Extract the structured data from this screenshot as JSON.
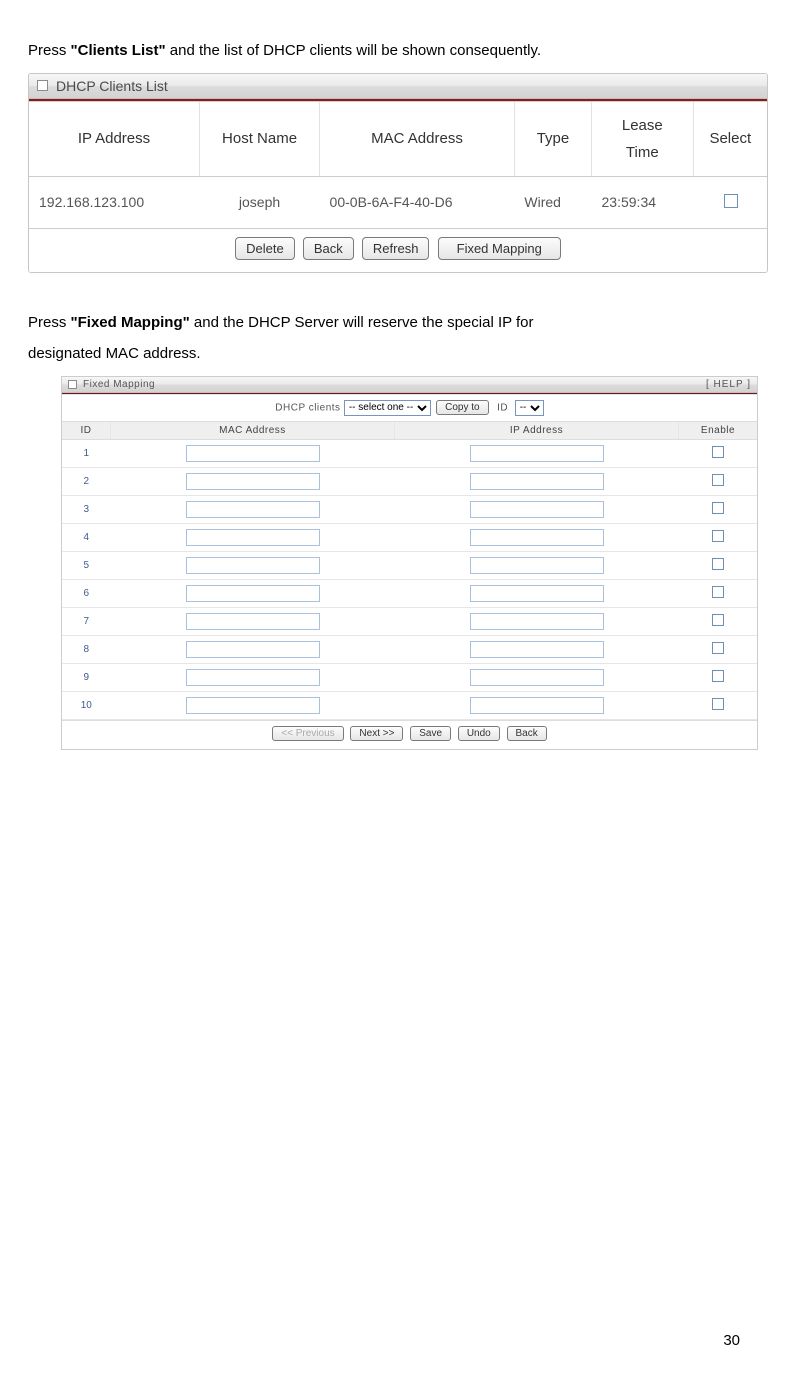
{
  "intro": {
    "pre": "Press ",
    "bold": "\"Clients List\"",
    "post": " and the list of DHCP clients will be shown consequently."
  },
  "clients_panel": {
    "title": "DHCP Clients List",
    "columns": {
      "ip": "IP Address",
      "host": "Host Name",
      "mac": "MAC Address",
      "type": "Type",
      "lease1": "Lease",
      "lease2": "Time",
      "select": "Select"
    },
    "row": {
      "ip": "192.168.123.100",
      "host": "joseph",
      "mac": "00-0B-6A-F4-40-D6",
      "type": "Wired",
      "lease": "23:59:34"
    },
    "buttons": {
      "delete": "Delete",
      "back": "Back",
      "refresh": "Refresh",
      "fixed": "Fixed Mapping"
    }
  },
  "intro2": {
    "pre": "Press ",
    "bold": "\"Fixed Mapping\"",
    "post1": " and the DHCP Server will reserve the special IP for",
    "post2": "designated MAC address."
  },
  "mapping_panel": {
    "title": "Fixed Mapping",
    "help": "[ HELP ]",
    "dhcp_label": "DHCP clients",
    "select_one": "-- select one --",
    "copy_to": "Copy to",
    "id_label": "ID",
    "id_dash": "--",
    "columns": {
      "id": "ID",
      "mac": "MAC Address",
      "ip": "IP Address",
      "enable": "Enable"
    },
    "rows": [
      {
        "id": "1"
      },
      {
        "id": "2"
      },
      {
        "id": "3"
      },
      {
        "id": "4"
      },
      {
        "id": "5"
      },
      {
        "id": "6"
      },
      {
        "id": "7"
      },
      {
        "id": "8"
      },
      {
        "id": "9"
      },
      {
        "id": "10"
      }
    ],
    "nav": {
      "prev": "<< Previous",
      "next": "Next >>",
      "save": "Save",
      "undo": "Undo",
      "back": "Back"
    }
  },
  "page_number": "30"
}
